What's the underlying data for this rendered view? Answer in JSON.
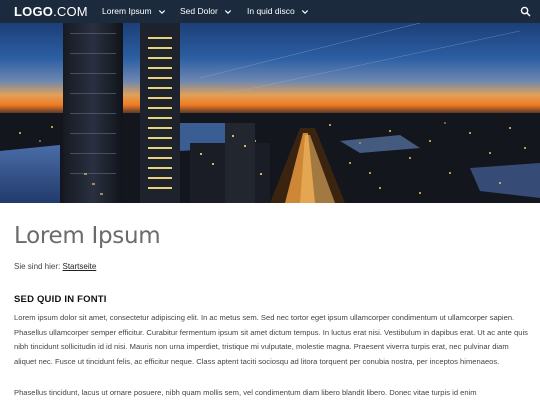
{
  "navbar": {
    "logo_main": "LOGO",
    "logo_suffix": ".COM",
    "items": [
      {
        "label": "Lorem Ipsum"
      },
      {
        "label": "Sed Dolor"
      },
      {
        "label": "In quid disco"
      }
    ],
    "search_icon": "search-icon"
  },
  "hero": {
    "description_icon": "city-skyline-night-image"
  },
  "main": {
    "title": "Lorem Ipsum",
    "breadcrumb": {
      "prefix": "Sie sind hier:",
      "link": "Startseite"
    },
    "section_heading": "SED QUID IN FONTI",
    "paragraphs": [
      "Lorem ipsum dolor sit amet, consectetur adipiscing elit. In ac metus sem. Sed nec tortor eget ipsum ullamcorper condimentum ut ullamcorper sapien. Phasellus ullamcorper semper efficitur. Curabitur fermentum ipsum sit amet dictum tempus. In luctus erat nisi. Vestibulum in dapibus erat. Ut ac ante quis nibh tincidunt sollicitudin id id nisi. Mauris non urna imperdiet, tristique mi vulputate, molestie magna. Praesent viverra turpis erat, nec pulvinar diam aliquet nec. Fusce ut tincidunt felis, ac efficitur neque. Class aptent taciti sociosqu ad litora torquent per conubia nostra, per inceptos himenaeos.",
      "Phasellus tincidunt, lacus ut ornare posuere, nibh quam mollis sem, vel condimentum diam libero blandit libero. Donec vitae turpis id enim"
    ]
  },
  "colors": {
    "navbar_bg": "#1b2a3c",
    "title_color": "#6b6b6b",
    "text_color": "#444444"
  }
}
